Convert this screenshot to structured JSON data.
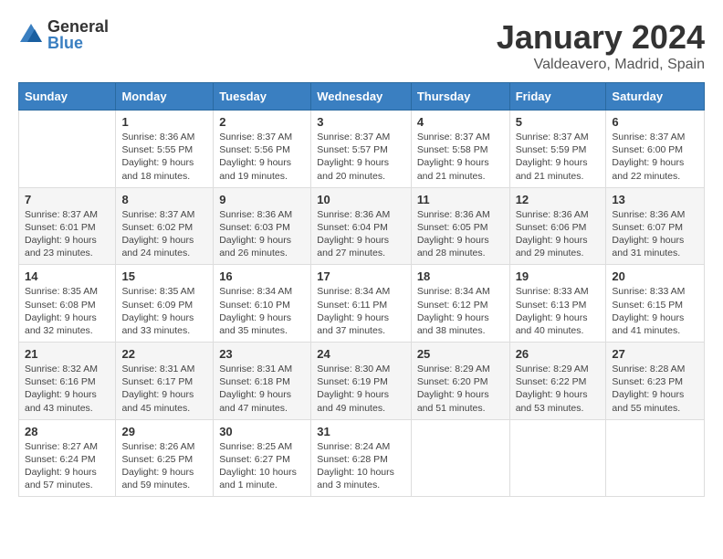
{
  "header": {
    "logo_general": "General",
    "logo_blue": "Blue",
    "month_title": "January 2024",
    "location": "Valdeavero, Madrid, Spain"
  },
  "columns": [
    "Sunday",
    "Monday",
    "Tuesday",
    "Wednesday",
    "Thursday",
    "Friday",
    "Saturday"
  ],
  "rows": [
    [
      {
        "num": "",
        "text": ""
      },
      {
        "num": "1",
        "text": "Sunrise: 8:36 AM\nSunset: 5:55 PM\nDaylight: 9 hours\nand 18 minutes."
      },
      {
        "num": "2",
        "text": "Sunrise: 8:37 AM\nSunset: 5:56 PM\nDaylight: 9 hours\nand 19 minutes."
      },
      {
        "num": "3",
        "text": "Sunrise: 8:37 AM\nSunset: 5:57 PM\nDaylight: 9 hours\nand 20 minutes."
      },
      {
        "num": "4",
        "text": "Sunrise: 8:37 AM\nSunset: 5:58 PM\nDaylight: 9 hours\nand 21 minutes."
      },
      {
        "num": "5",
        "text": "Sunrise: 8:37 AM\nSunset: 5:59 PM\nDaylight: 9 hours\nand 21 minutes."
      },
      {
        "num": "6",
        "text": "Sunrise: 8:37 AM\nSunset: 6:00 PM\nDaylight: 9 hours\nand 22 minutes."
      }
    ],
    [
      {
        "num": "7",
        "text": "Sunrise: 8:37 AM\nSunset: 6:01 PM\nDaylight: 9 hours\nand 23 minutes."
      },
      {
        "num": "8",
        "text": "Sunrise: 8:37 AM\nSunset: 6:02 PM\nDaylight: 9 hours\nand 24 minutes."
      },
      {
        "num": "9",
        "text": "Sunrise: 8:36 AM\nSunset: 6:03 PM\nDaylight: 9 hours\nand 26 minutes."
      },
      {
        "num": "10",
        "text": "Sunrise: 8:36 AM\nSunset: 6:04 PM\nDaylight: 9 hours\nand 27 minutes."
      },
      {
        "num": "11",
        "text": "Sunrise: 8:36 AM\nSunset: 6:05 PM\nDaylight: 9 hours\nand 28 minutes."
      },
      {
        "num": "12",
        "text": "Sunrise: 8:36 AM\nSunset: 6:06 PM\nDaylight: 9 hours\nand 29 minutes."
      },
      {
        "num": "13",
        "text": "Sunrise: 8:36 AM\nSunset: 6:07 PM\nDaylight: 9 hours\nand 31 minutes."
      }
    ],
    [
      {
        "num": "14",
        "text": "Sunrise: 8:35 AM\nSunset: 6:08 PM\nDaylight: 9 hours\nand 32 minutes."
      },
      {
        "num": "15",
        "text": "Sunrise: 8:35 AM\nSunset: 6:09 PM\nDaylight: 9 hours\nand 33 minutes."
      },
      {
        "num": "16",
        "text": "Sunrise: 8:34 AM\nSunset: 6:10 PM\nDaylight: 9 hours\nand 35 minutes."
      },
      {
        "num": "17",
        "text": "Sunrise: 8:34 AM\nSunset: 6:11 PM\nDaylight: 9 hours\nand 37 minutes."
      },
      {
        "num": "18",
        "text": "Sunrise: 8:34 AM\nSunset: 6:12 PM\nDaylight: 9 hours\nand 38 minutes."
      },
      {
        "num": "19",
        "text": "Sunrise: 8:33 AM\nSunset: 6:13 PM\nDaylight: 9 hours\nand 40 minutes."
      },
      {
        "num": "20",
        "text": "Sunrise: 8:33 AM\nSunset: 6:15 PM\nDaylight: 9 hours\nand 41 minutes."
      }
    ],
    [
      {
        "num": "21",
        "text": "Sunrise: 8:32 AM\nSunset: 6:16 PM\nDaylight: 9 hours\nand 43 minutes."
      },
      {
        "num": "22",
        "text": "Sunrise: 8:31 AM\nSunset: 6:17 PM\nDaylight: 9 hours\nand 45 minutes."
      },
      {
        "num": "23",
        "text": "Sunrise: 8:31 AM\nSunset: 6:18 PM\nDaylight: 9 hours\nand 47 minutes."
      },
      {
        "num": "24",
        "text": "Sunrise: 8:30 AM\nSunset: 6:19 PM\nDaylight: 9 hours\nand 49 minutes."
      },
      {
        "num": "25",
        "text": "Sunrise: 8:29 AM\nSunset: 6:20 PM\nDaylight: 9 hours\nand 51 minutes."
      },
      {
        "num": "26",
        "text": "Sunrise: 8:29 AM\nSunset: 6:22 PM\nDaylight: 9 hours\nand 53 minutes."
      },
      {
        "num": "27",
        "text": "Sunrise: 8:28 AM\nSunset: 6:23 PM\nDaylight: 9 hours\nand 55 minutes."
      }
    ],
    [
      {
        "num": "28",
        "text": "Sunrise: 8:27 AM\nSunset: 6:24 PM\nDaylight: 9 hours\nand 57 minutes."
      },
      {
        "num": "29",
        "text": "Sunrise: 8:26 AM\nSunset: 6:25 PM\nDaylight: 9 hours\nand 59 minutes."
      },
      {
        "num": "30",
        "text": "Sunrise: 8:25 AM\nSunset: 6:27 PM\nDaylight: 10 hours\nand 1 minute."
      },
      {
        "num": "31",
        "text": "Sunrise: 8:24 AM\nSunset: 6:28 PM\nDaylight: 10 hours\nand 3 minutes."
      },
      {
        "num": "",
        "text": ""
      },
      {
        "num": "",
        "text": ""
      },
      {
        "num": "",
        "text": ""
      }
    ]
  ]
}
